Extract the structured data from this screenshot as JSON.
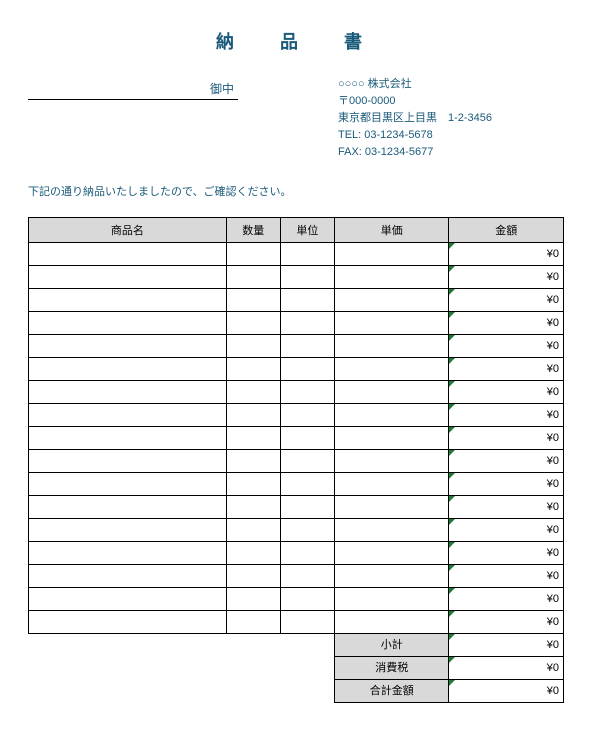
{
  "title": "納　品　書",
  "recipient_suffix": "御中",
  "company": {
    "name": "○○○○ 株式会社",
    "postal": "〒000-0000",
    "address": "東京都目黒区上目黒　1-2-3456",
    "tel": "TEL: 03-1234-5678",
    "fax": "FAX: 03-1234-5677"
  },
  "confirm_text": "下記の通り納品いたしましたので、ご確認ください。",
  "headers": {
    "name": "商品名",
    "qty": "数量",
    "unit": "単位",
    "price": "単価",
    "amount": "金額"
  },
  "rows": [
    {
      "amount": "¥0"
    },
    {
      "amount": "¥0"
    },
    {
      "amount": "¥0"
    },
    {
      "amount": "¥0"
    },
    {
      "amount": "¥0"
    },
    {
      "amount": "¥0"
    },
    {
      "amount": "¥0"
    },
    {
      "amount": "¥0"
    },
    {
      "amount": "¥0"
    },
    {
      "amount": "¥0"
    },
    {
      "amount": "¥0"
    },
    {
      "amount": "¥0"
    },
    {
      "amount": "¥0"
    },
    {
      "amount": "¥0"
    },
    {
      "amount": "¥0"
    },
    {
      "amount": "¥0"
    },
    {
      "amount": "¥0"
    }
  ],
  "summary": {
    "subtotal_label": "小計",
    "subtotal_value": "¥0",
    "tax_label": "消費税",
    "tax_value": "¥0",
    "total_label": "合計金額",
    "total_value": "¥0"
  }
}
